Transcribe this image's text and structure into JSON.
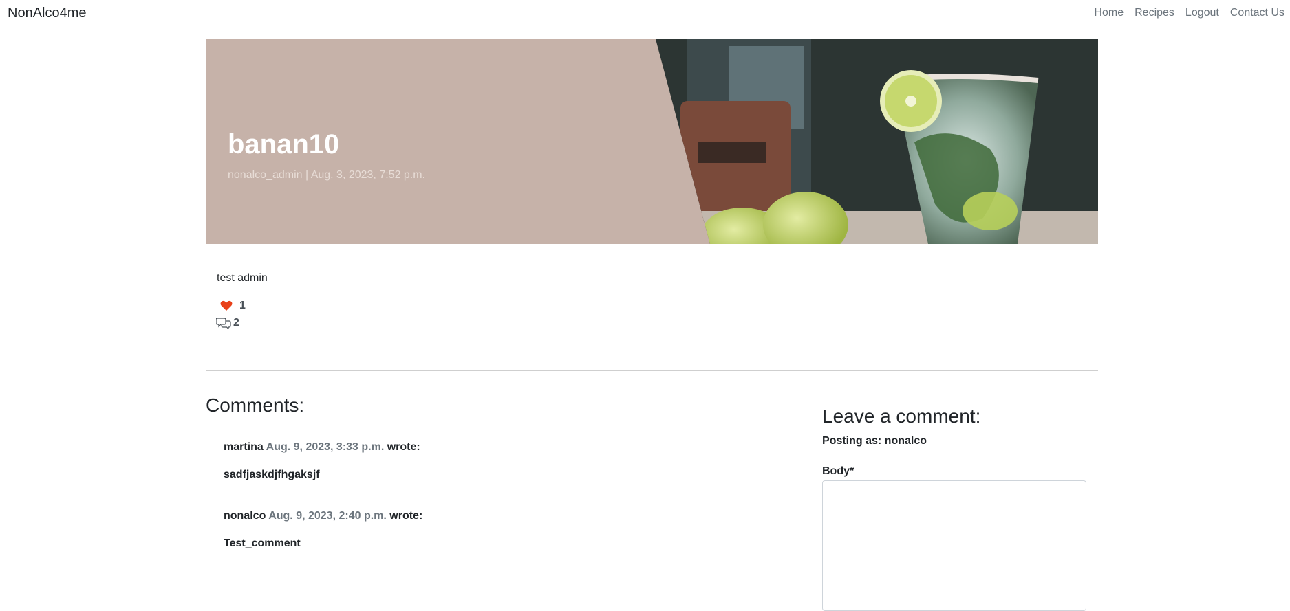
{
  "navbar": {
    "brand": "NonAlco4me",
    "links": [
      "Home",
      "Recipes",
      "Logout",
      "Contact Us"
    ]
  },
  "post": {
    "title": "banan10",
    "meta": "nonalco_admin | Aug. 3, 2023, 7:52 p.m.",
    "content": "test admin",
    "likes": "1",
    "comments_count": "2",
    "like_icon": "heart-icon",
    "comment_icon": "chat-bubbles-icon",
    "hero_image": "mojito-glass-with-limes"
  },
  "comments_section": {
    "heading": "Comments:",
    "items": [
      {
        "author": "martina",
        "date": "Aug. 9, 2023, 3:33 p.m.",
        "wrote": "wrote:",
        "body": "sadfjaskdjfhgaksjf"
      },
      {
        "author": "nonalco",
        "date": "Aug. 9, 2023, 2:40 p.m.",
        "wrote": "wrote:",
        "body": "Test_comment"
      }
    ]
  },
  "comment_form": {
    "heading": "Leave a comment:",
    "posting_as": "Posting as: nonalco",
    "body_label": "Body*",
    "body_value": ""
  },
  "colors": {
    "hero_bg": "#c6b2a9",
    "heart": "#e8411a",
    "muted": "#6c757d"
  }
}
